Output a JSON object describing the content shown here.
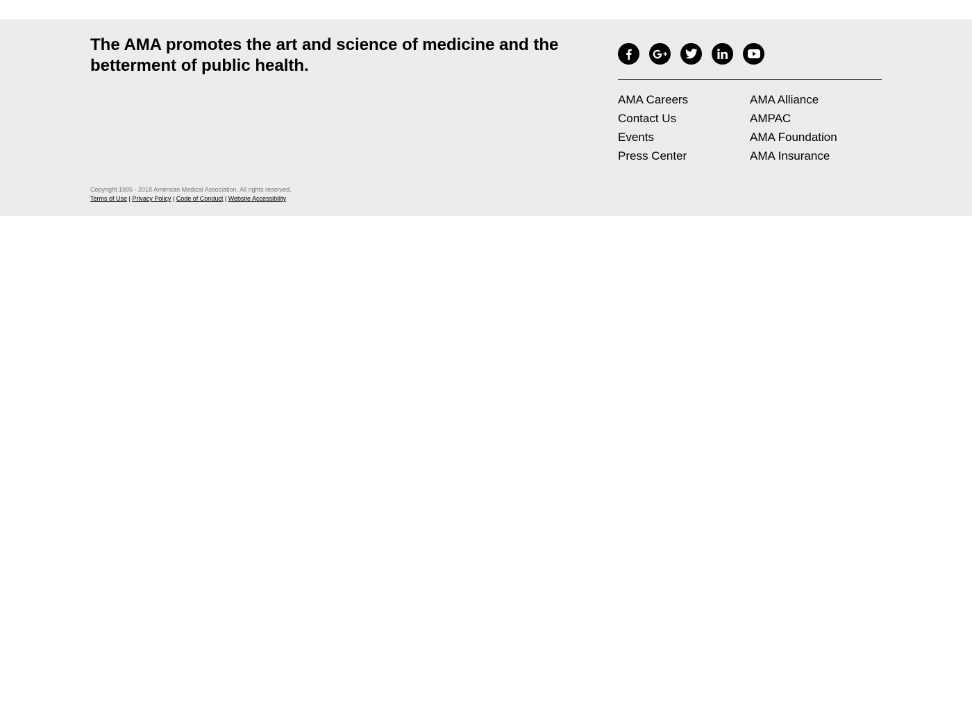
{
  "footer": {
    "tagline": "The AMA promotes the art and science of medicine and the betterment of public health.",
    "social": [
      {
        "name": "facebook",
        "icon": "facebook-icon"
      },
      {
        "name": "google-plus",
        "icon": "google-plus-icon"
      },
      {
        "name": "twitter",
        "icon": "twitter-icon"
      },
      {
        "name": "linkedin",
        "icon": "linkedin-icon"
      },
      {
        "name": "youtube",
        "icon": "youtube-icon"
      }
    ],
    "links_col1": [
      "AMA Careers",
      "Contact Us",
      "Events",
      "Press Center"
    ],
    "links_col2": [
      "AMA Alliance",
      "AMPAC",
      "AMA Foundation",
      "AMA Insurance"
    ],
    "copyright": "Copyright 1995 - 2018 American Medical Association. All rights reserved.",
    "legal_links": [
      "Terms of Use",
      "Privacy Policy",
      "Code of Conduct",
      "Website Accessibility"
    ],
    "separator": "|"
  },
  "colors": {
    "footer_bg": "#ececec",
    "icon_bg": "#000000",
    "text": "#000000",
    "copyright_text": "#777777"
  }
}
